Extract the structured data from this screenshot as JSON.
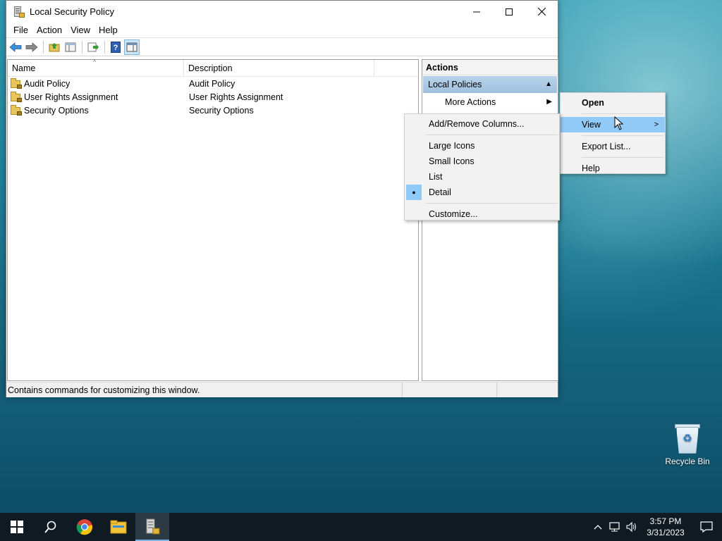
{
  "window": {
    "title": "Local Security Policy",
    "controls": {
      "minimize": "—",
      "maximize": "☐",
      "close": "✕"
    }
  },
  "menubar": [
    "File",
    "Action",
    "View",
    "Help"
  ],
  "toolbar": {
    "icons": [
      "back-arrow-icon",
      "forward-arrow-icon",
      "up-folder-icon",
      "show-hide-tree-icon",
      "export-list-icon",
      "help-icon",
      "show-hide-action-pane-icon"
    ]
  },
  "list": {
    "columns": [
      "Name",
      "Description"
    ],
    "sort_indicator": "^",
    "rows": [
      {
        "name": "Audit Policy",
        "description": "Audit Policy"
      },
      {
        "name": "User Rights Assignment",
        "description": "User Rights Assignment"
      },
      {
        "name": "Security Options",
        "description": "Security Options"
      }
    ]
  },
  "actions": {
    "title": "Actions",
    "section": "Local Policies",
    "section_arrow": "▲",
    "more_actions": "More Actions",
    "more_arrow": "▶"
  },
  "statusbar": {
    "text": "Contains commands for customizing this window."
  },
  "context_menu": {
    "open": "Open",
    "view": "View",
    "view_arrow": ">",
    "export_list": "Export List...",
    "help": "Help"
  },
  "view_submenu": {
    "add_remove_columns": "Add/Remove Columns...",
    "large_icons": "Large Icons",
    "small_icons": "Small Icons",
    "list": "List",
    "detail": "Detail",
    "detail_bullet": "●",
    "customize": "Customize..."
  },
  "desktop": {
    "recycle_bin": "Recycle Bin"
  },
  "taskbar": {
    "time": "3:57 PM",
    "date": "3/31/2023",
    "tray_chevron": "^"
  }
}
